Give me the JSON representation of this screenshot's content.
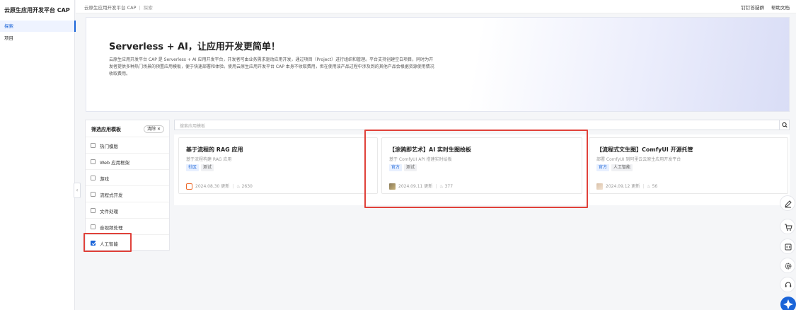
{
  "sidebar": {
    "brand": "云原生应用开发平台 CAP",
    "items": [
      {
        "label": "探索",
        "active": true
      },
      {
        "label": "项目",
        "active": false
      }
    ]
  },
  "topbar": {
    "breadcrumb": {
      "root": "云原生应用开发平台 CAP",
      "separator": "|",
      "current": "探索"
    },
    "links": [
      "钉钉答疑群",
      "帮助文档"
    ]
  },
  "hero": {
    "title": "Serverless + AI，让应用开发更简单！",
    "description": "云原生应用开发平台 CAP 是 Serverless + AI 应用开发平台，开发者可由业务需求驱动应用开发，通过项目（Project）进行组织和管理。平台支持创建空白项目，同时为开发者提供多种热门场景的预置应用模板，便于快速部署和体验。使用云原生应用开发平台 CAP 本身不收取费用，但在使用该产品过程中涉及到的其他产品会根据资源使用情况收取费用。"
  },
  "filter": {
    "title": "筛选应用模板",
    "clear_label": "清除 ✕",
    "options": [
      {
        "label": "热门模版",
        "checked": false
      },
      {
        "label": "Web 应用框架",
        "checked": false
      },
      {
        "label": "游戏",
        "checked": false
      },
      {
        "label": "流程式开发",
        "checked": false
      },
      {
        "label": "文件处理",
        "checked": false
      },
      {
        "label": "音视频处理",
        "checked": false
      },
      {
        "label": "人工智能",
        "checked": true
      }
    ]
  },
  "search": {
    "placeholder": "搜索应用模板"
  },
  "cards": [
    {
      "title": "基于流程的 RAG 应用",
      "description": "基于流程构建 RAG 应用",
      "tags": [
        "社区",
        "测试"
      ],
      "updated": "2024.08.30 更新",
      "count": "2630"
    },
    {
      "title": "【涂鸦即艺术】AI 实时生图绘板",
      "description": "基于 ComfyUI API 搭建实时绘板",
      "tags": [
        "官方",
        "测试"
      ],
      "updated": "2024.09.11 更新",
      "count": "377"
    },
    {
      "title": "【流程式文生图】ComfyUI 开源托管",
      "description": "部署 ComfyUI 到阿里云云原生应用开发平台",
      "tags": [
        "官方",
        "人工智能"
      ],
      "updated": "2024.09.12 更新",
      "count": "56"
    }
  ],
  "icons": {
    "collapse": "chevron-left-icon",
    "search": "search-icon",
    "fire": "fire-icon",
    "float": [
      "edit-icon",
      "cart-icon",
      "code-icon",
      "gear-icon",
      "headset-icon",
      "assistant-icon"
    ]
  },
  "colors": {
    "accent": "#1a64d8",
    "highlight": "#e0413a"
  }
}
